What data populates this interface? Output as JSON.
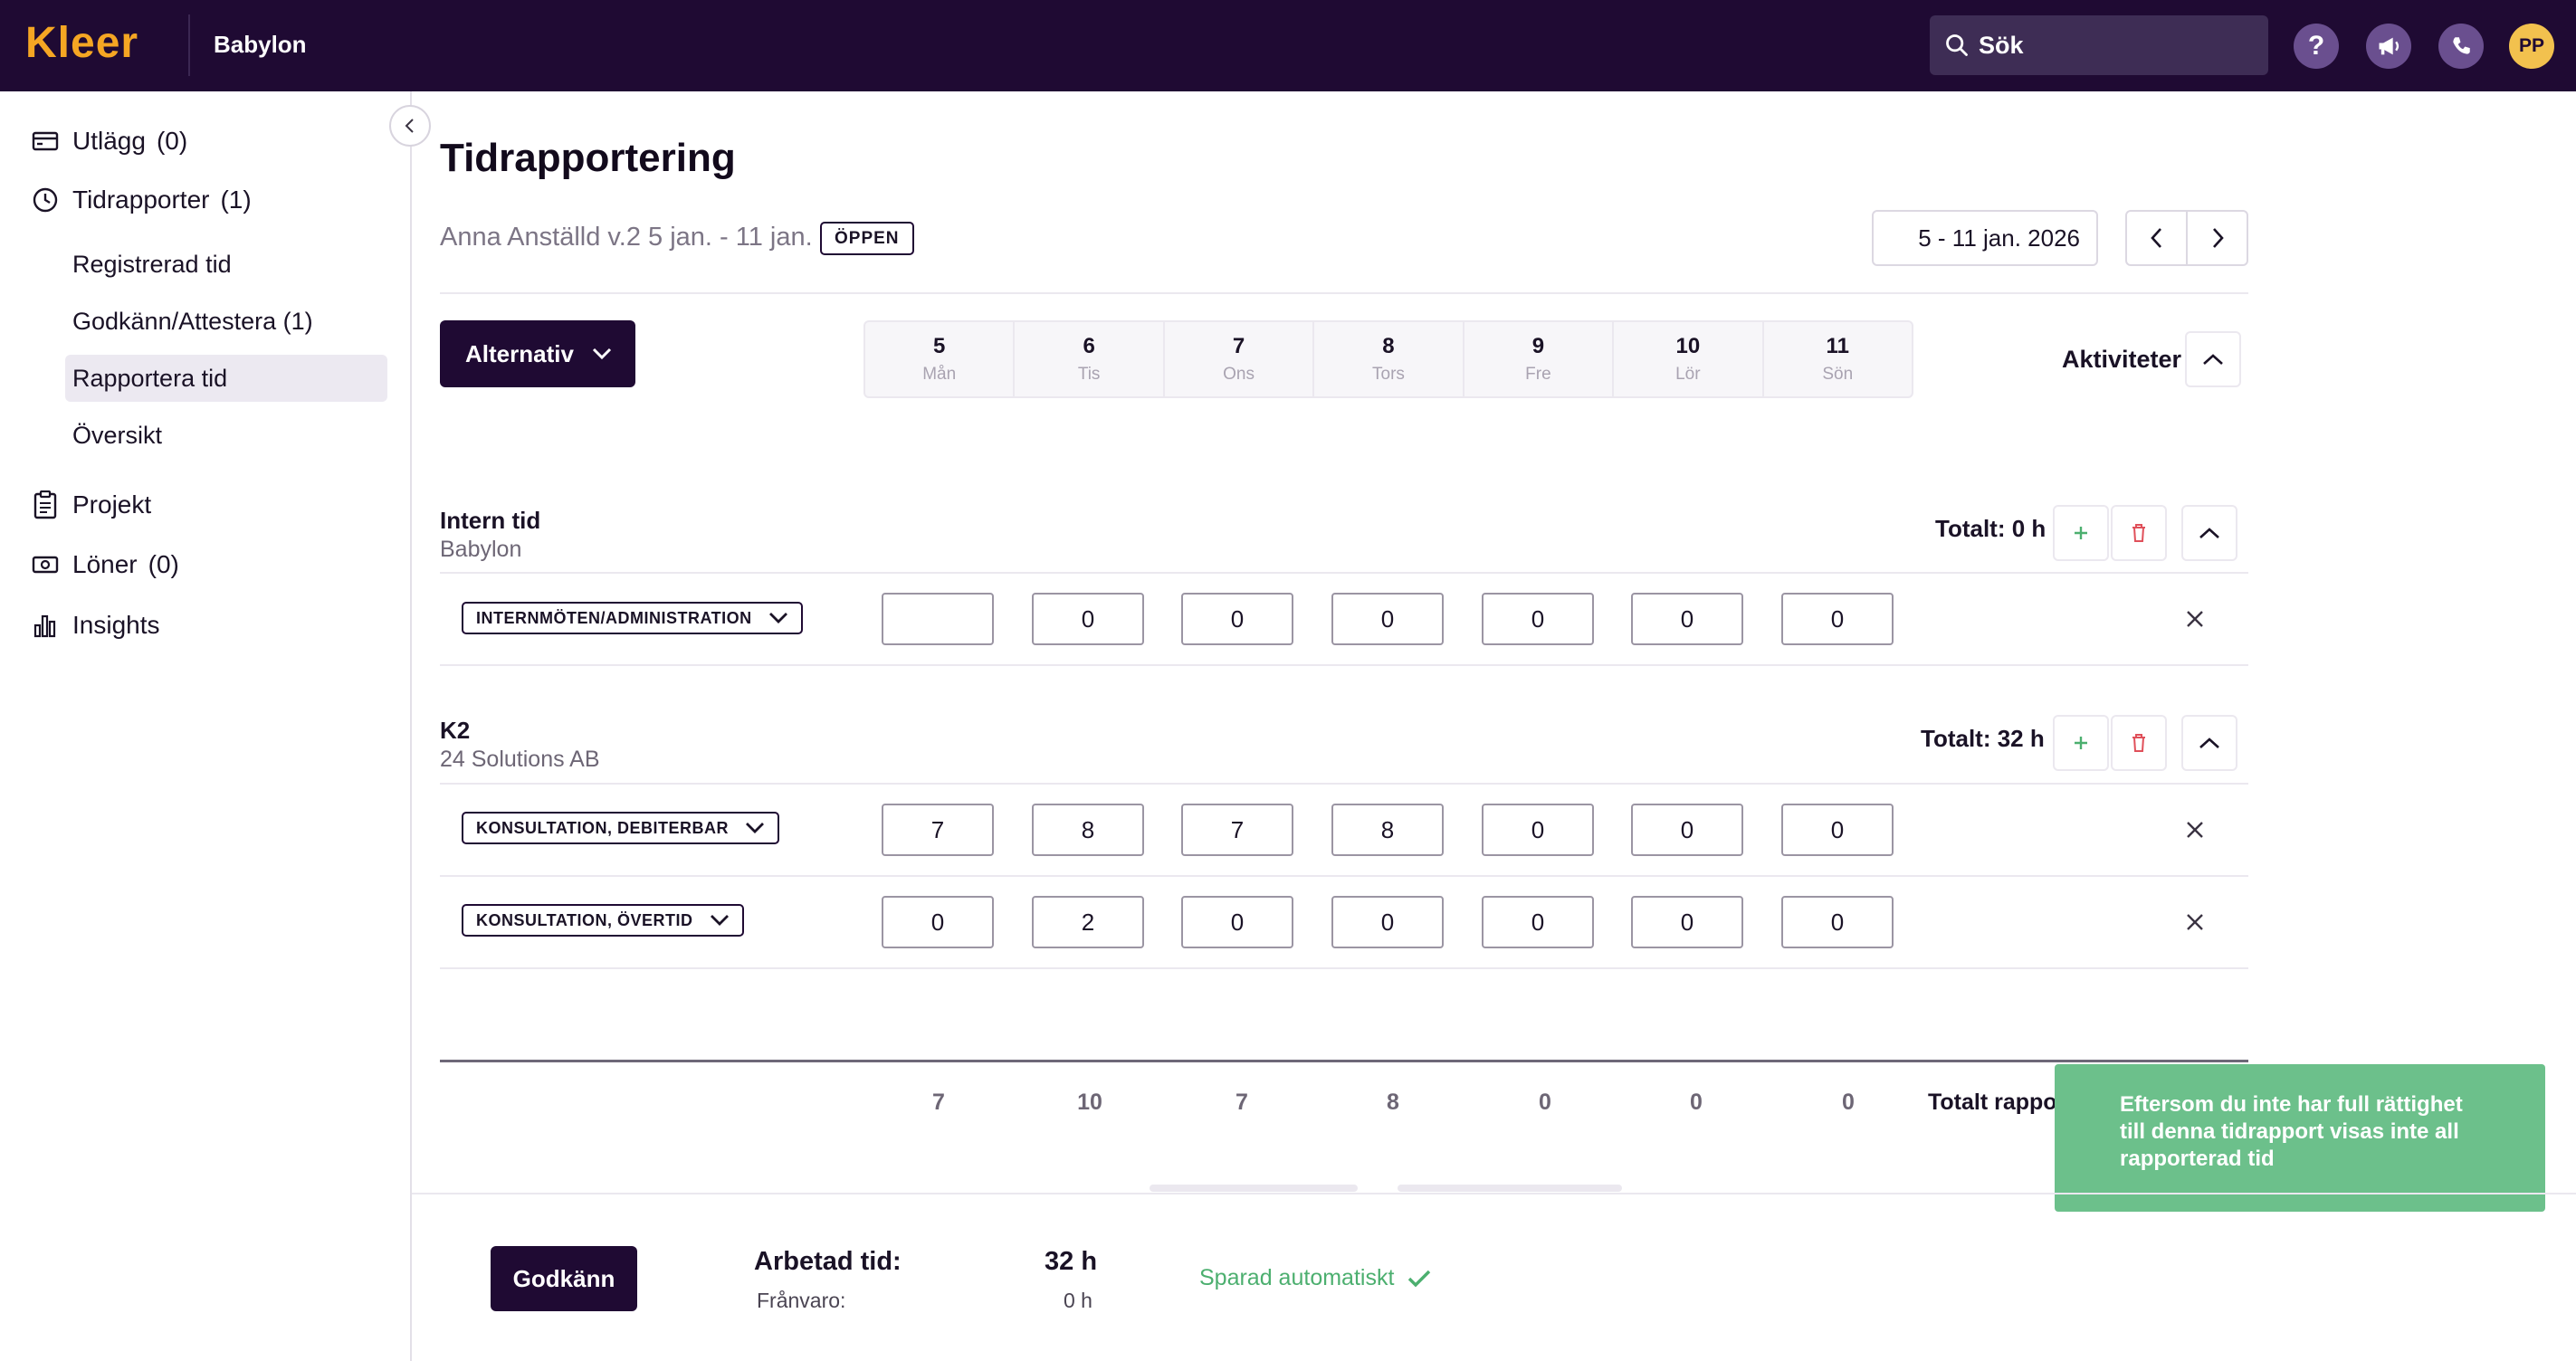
{
  "app": {
    "logo_text": "Kleer",
    "org_name": "Babylon",
    "search_placeholder": "Sök",
    "avatar_initials": "PP",
    "help_glyph": "?"
  },
  "sidebar": {
    "items": [
      {
        "label": "Utlägg",
        "count": "(0)",
        "icon": "receipt-icon"
      },
      {
        "label": "Tidrapporter",
        "count": "(1)",
        "icon": "clock-icon"
      },
      {
        "label": "Projekt",
        "count": "",
        "icon": "clipboard-icon"
      },
      {
        "label": "Löner",
        "count": "(0)",
        "icon": "cash-icon"
      },
      {
        "label": "Insights",
        "count": "",
        "icon": "bar-chart-icon"
      }
    ],
    "sub_items": [
      "Registrerad tid",
      "Godkänn/Attestera (1)",
      "Rapportera tid",
      "Översikt"
    ],
    "active_sub": "Rapportera tid"
  },
  "page": {
    "title": "Tidrapportering",
    "subtitle": "Anna Anställd v.2 5 jan. - 11 jan.",
    "status_badge": "ÖPPEN",
    "date_range": "5 - 11 jan. 2026",
    "options_button": "Alternativ",
    "activities_label": "Aktiviteter"
  },
  "days": [
    {
      "num": "5",
      "name": "Mån"
    },
    {
      "num": "6",
      "name": "Tis"
    },
    {
      "num": "7",
      "name": "Ons"
    },
    {
      "num": "8",
      "name": "Tors"
    },
    {
      "num": "9",
      "name": "Fre"
    },
    {
      "num": "10",
      "name": "Lör"
    },
    {
      "num": "11",
      "name": "Sön"
    }
  ],
  "groups": [
    {
      "title": "Intern tid",
      "subtitle": "Babylon",
      "total": "Totalt: 0 h",
      "rows": [
        {
          "activity": "INTERNMÖTEN/ADMINISTRATION",
          "values": [
            "",
            "0",
            "0",
            "0",
            "0",
            "0",
            "0"
          ]
        }
      ]
    },
    {
      "title": "K2",
      "subtitle": "24 Solutions AB",
      "total": "Totalt: 32 h",
      "rows": [
        {
          "activity": "KONSULTATION, DEBITERBAR",
          "values": [
            "7",
            "8",
            "7",
            "8",
            "0",
            "0",
            "0"
          ]
        },
        {
          "activity": "KONSULTATION, ÖVERTID",
          "values": [
            "0",
            "2",
            "0",
            "0",
            "0",
            "0",
            "0"
          ]
        }
      ]
    }
  ],
  "totals": {
    "values": [
      "7",
      "10",
      "7",
      "8",
      "0",
      "0",
      "0"
    ],
    "label": "Totalt rapporterad tid:"
  },
  "toast": {
    "message": "Eftersom du inte har full rättighet till denna tidrapport visas inte all rapporterad tid",
    "color": "#6cc08b"
  },
  "footer": {
    "approve_button": "Godkänn",
    "worked_label": "Arbetad tid:",
    "worked_value": "32 h",
    "absence_label": "Frånvaro:",
    "absence_value": "0 h",
    "autosave": "Sparad automatiskt"
  },
  "colors": {
    "brand_dark": "#1f0a33",
    "brand_orange": "#f5a623",
    "success": "#4caf6f",
    "danger": "#e0505a"
  }
}
